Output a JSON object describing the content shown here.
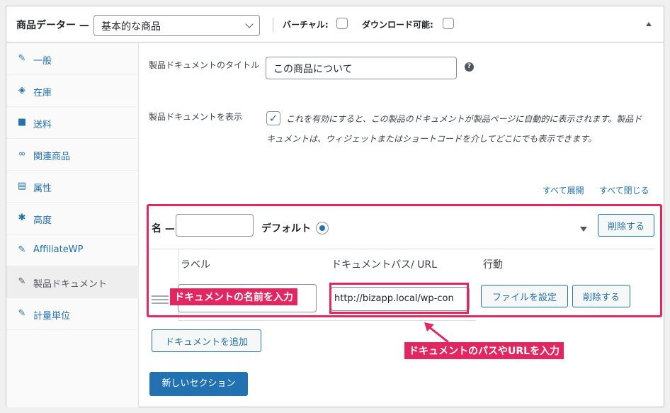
{
  "header": {
    "title": "商品データー —",
    "product_type": "基本的な商品",
    "virtual_label": "バーチャル:",
    "downloadable_label": "ダウンロード可能:"
  },
  "sidebar": {
    "items": [
      {
        "label": "一般",
        "icon": "wrench-icon"
      },
      {
        "label": "在庫",
        "icon": "tag-icon"
      },
      {
        "label": "送料",
        "icon": "truck-icon"
      },
      {
        "label": "関連商品",
        "icon": "link-icon"
      },
      {
        "label": "属性",
        "icon": "list-icon"
      },
      {
        "label": "高度",
        "icon": "gear-icon"
      },
      {
        "label": "AffiliateWP",
        "icon": "wrench-icon"
      },
      {
        "label": "製品ドキュメント",
        "icon": "wrench-icon"
      },
      {
        "label": "計量単位",
        "icon": "wrench-icon"
      }
    ]
  },
  "main": {
    "doc_title_label": "製品ドキュメントのタイトル",
    "doc_title_value": "この商品について",
    "help_glyph": "?",
    "show_label": "製品ドキュメントを表示",
    "show_description": "これを有効にすると、この製品のドキュメントが製品ページに自動的に表示されます。製品ドキュメントは、ウィジェットまたはショートコードを介してどこにでも表示できます。",
    "expand_all": "すべて展開",
    "collapse_all": "すべて閉じる"
  },
  "section": {
    "name_label": "名 —",
    "default_label": "デフォルト",
    "delete_label": "削除する",
    "columns": {
      "label": "ラベル",
      "path": "ドキュメントパス/ URL",
      "action": "行動"
    },
    "row": {
      "path_value": "http://bizapp.local/wp-con",
      "set_file_label": "ファイルを設定",
      "delete_label": "削除する"
    },
    "add_doc_label": "ドキュメントを追加"
  },
  "new_section_label": "新しいセクション",
  "annotations": {
    "name_hint": "ドキュメントの名前を入力",
    "path_hint": "ドキュメントのパスやURLを入力"
  },
  "colors": {
    "accent": "#2271b1",
    "annotation": "#e3265f"
  }
}
